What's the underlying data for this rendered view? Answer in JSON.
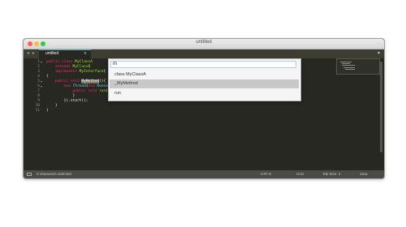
{
  "window": {
    "title": "untitled"
  },
  "tabbar": {
    "nav_arrows": "◂ ▸",
    "tab_label": "untitled",
    "tab_close": "×",
    "dropdown": "▾"
  },
  "gutter": {
    "line_numbers": [
      "1",
      "2",
      "3",
      "4",
      "5",
      "6",
      "7",
      "8",
      "9",
      "10",
      "11"
    ]
  },
  "code": {
    "lines": [
      "public class MyClassA",
      "    extends MyClassB",
      "    implements MyInterface{",
      "{",
      "    public void MyMethod(){",
      "        new Thread(new Runnable(){",
      "            public void run(){",
      "            }",
      "        }).start();",
      "    }",
      "}"
    ]
  },
  "popup": {
    "input_value": "m",
    "items": [
      {
        "label": "class MyClassA",
        "selected": false
      },
      {
        "label": "_MyMethod",
        "selected": true
      },
      {
        "label": "run",
        "selected": false
      }
    ]
  },
  "statusbar": {
    "selection": "0 characters selected",
    "encoding": "UTF-8",
    "line_endings": "Unix",
    "tab_size": "Tab Size: 4",
    "syntax": "Java"
  },
  "colors": {
    "editor_bg": "#272822",
    "keyword": "#f92672",
    "type": "#66d9ef",
    "class_name": "#a6e22e",
    "statusbar_bg": "#4b4b45"
  }
}
